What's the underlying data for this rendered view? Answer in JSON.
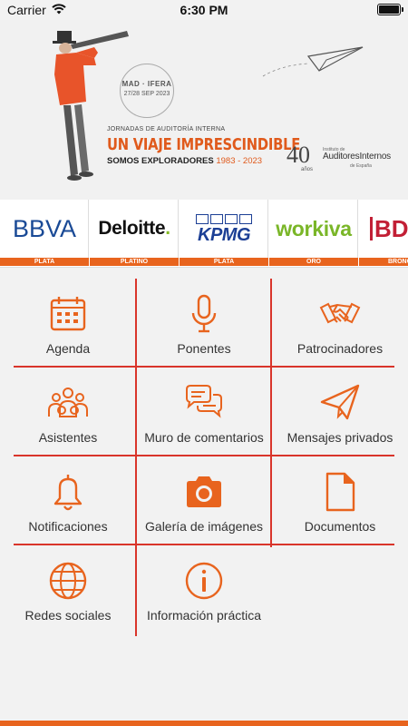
{
  "status_bar": {
    "carrier": "Carrier",
    "time": "6:30 PM"
  },
  "banner": {
    "stamp_line1": "MAD · IFERA",
    "stamp_line2": "27/28 SEP 2023",
    "kicker": "JORNADAS DE AUDITORÍA INTERNA",
    "title": "UN VIAJE IMPRESCINDIBLE",
    "subtitle": "SOMOS EXPLORADORES",
    "years": "1983 - 2023",
    "logo_number": "40",
    "logo_anos": "años",
    "logo_institute": "Instituto de",
    "logo_name": "AuditoresInternos",
    "logo_country": "de España"
  },
  "sponsors": [
    {
      "name": "BBVA",
      "level": "PLATA"
    },
    {
      "name": "Deloitte",
      "dot": ".",
      "level": "PLATINO"
    },
    {
      "name": "KPMG",
      "level": "PLATA"
    },
    {
      "name": "workiva",
      "level": "ORO"
    },
    {
      "name": "BDO",
      "level": "BRONCE"
    }
  ],
  "menu": {
    "agenda": "Agenda",
    "ponentes": "Ponentes",
    "patrocinadores": "Patrocinadores",
    "asistentes": "Asistentes",
    "muro": "Muro de comentarios",
    "mensajes": "Mensajes privados",
    "notificaciones": "Notificaciones",
    "galeria": "Galería de imágenes",
    "documentos": "Documentos",
    "redes": "Redes sociales",
    "info": "Información práctica"
  },
  "colors": {
    "accent": "#e8641e",
    "grid_line": "#d9352b",
    "background": "#f2f2f2"
  }
}
